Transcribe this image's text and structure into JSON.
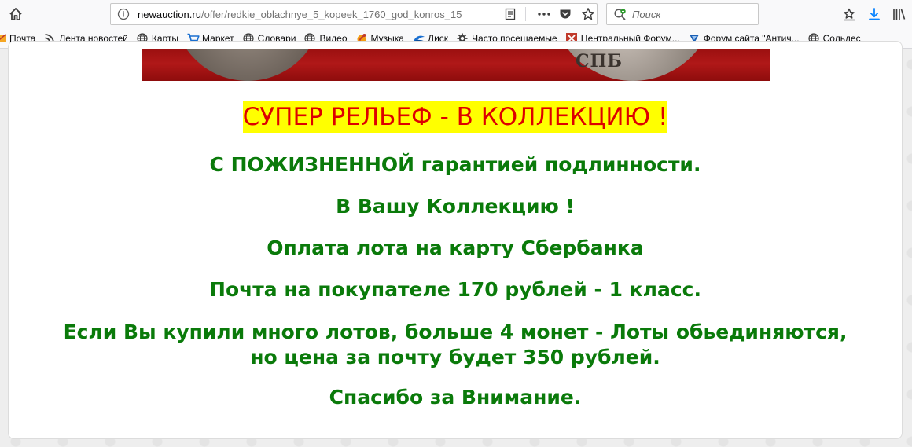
{
  "browser": {
    "url_domain": "newauction.ru",
    "url_path": "/offer/redkie_oblachnye_5_kopeek_1760_god_konros_15",
    "search_placeholder": "Поиск"
  },
  "bookmarks": [
    {
      "label": "Почта",
      "icon": "mail-icon"
    },
    {
      "label": "Лента новостей",
      "icon": "rss-icon"
    },
    {
      "label": "Карты",
      "icon": "globe-icon"
    },
    {
      "label": "Маркет",
      "icon": "cart-icon"
    },
    {
      "label": "Словари",
      "icon": "globe-icon"
    },
    {
      "label": "Видео",
      "icon": "globe-icon"
    },
    {
      "label": "Музыка",
      "icon": "music-icon"
    },
    {
      "label": "Диск",
      "icon": "disk-icon"
    },
    {
      "label": "Часто посещаемые",
      "icon": "gear-icon"
    },
    {
      "label": "Центральный Форум...",
      "icon": "forum-icon"
    },
    {
      "label": "Форум сайта \"Антич...",
      "icon": "forum2-icon"
    },
    {
      "label": "Сольдес",
      "icon": "globe-icon"
    }
  ],
  "content": {
    "coin_text": "СПБ",
    "headline": "СУПЕР РЕЛЬЕФ - В КОЛЛЕКЦИЮ !",
    "lines": [
      "С ПОЖИЗНЕННОЙ гарантией подлинности.",
      "В Вашу Коллекцию !",
      "Оплата лота на карту Сбербанка",
      "Почта на покупателе 170 рублей - 1 класс.",
      "Если Вы купили много лотов, больше 4 монет - Лоты обьединяются,",
      "но цена за почту будет 350 рублей.",
      "Спасибо за Внимание."
    ]
  },
  "colors": {
    "headline_bg": "#ffff00",
    "headline_text": "#dd0000",
    "green_text": "#0a7a0a"
  }
}
